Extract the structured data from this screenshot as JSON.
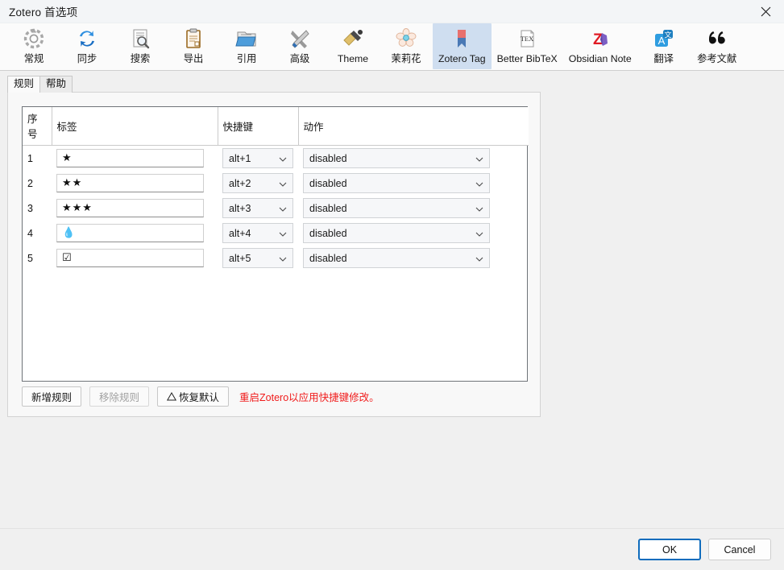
{
  "window": {
    "title": "Zotero 首选项",
    "close_label": "✕",
    "close_icon": "close-icon"
  },
  "toolbar": {
    "tabs": [
      {
        "label": "常规",
        "icon": "gear-icon",
        "selected": false
      },
      {
        "label": "同步",
        "icon": "sync-arrows-icon",
        "selected": false
      },
      {
        "label": "搜索",
        "icon": "document-search-icon",
        "selected": false
      },
      {
        "label": "导出",
        "icon": "clipboard-icon",
        "selected": false
      },
      {
        "label": "引用",
        "icon": "folder-icon",
        "selected": false
      },
      {
        "label": "高级",
        "icon": "tools-icon",
        "selected": false
      },
      {
        "label": "Theme",
        "icon": "paintbrush-icon",
        "selected": false
      },
      {
        "label": "茉莉花",
        "icon": "flower-icon",
        "selected": false
      },
      {
        "label": "Zotero Tag",
        "icon": "bookmark-icon",
        "selected": true
      },
      {
        "label": "Better BibTeX",
        "icon": "tex-document-icon",
        "selected": false
      },
      {
        "label": "Obsidian Note",
        "icon": "obsidian-icon",
        "selected": false
      },
      {
        "label": "翻译",
        "icon": "translate-icon",
        "selected": false
      },
      {
        "label": "参考文献",
        "icon": "quotation-marks-icon",
        "selected": false
      }
    ]
  },
  "subtabs": [
    {
      "label": "规则",
      "selected": true
    },
    {
      "label": "帮助",
      "selected": false
    }
  ],
  "rules_table": {
    "headers": [
      "序号",
      "标签",
      "快捷键",
      "动作"
    ],
    "rows": [
      {
        "index": "1",
        "tag": "★",
        "tag_icon": "star-1-icon",
        "shortcut": "alt+1",
        "action": "disabled"
      },
      {
        "index": "2",
        "tag": "★★",
        "tag_icon": "star-2-icon",
        "shortcut": "alt+2",
        "action": "disabled"
      },
      {
        "index": "3",
        "tag": "★★★",
        "tag_icon": "star-3-icon",
        "shortcut": "alt+3",
        "action": "disabled"
      },
      {
        "index": "4",
        "tag": "💧",
        "tag_icon": "droplet-icon",
        "shortcut": "alt+4",
        "action": "disabled"
      },
      {
        "index": "5",
        "tag": "☑",
        "tag_icon": "checkbox-icon",
        "shortcut": "alt+5",
        "action": "disabled"
      }
    ]
  },
  "panel_buttons": {
    "add_rule": "新增规则",
    "remove_rule": "移除规则",
    "restore_default": "恢复默认",
    "warning_icon": "warning-triangle-icon",
    "restart_notice": "重启Zotero以应用快捷键修改。"
  },
  "footer": {
    "ok": "OK",
    "cancel": "Cancel"
  },
  "colors": {
    "selected_tab_bg": "#cfdef2",
    "warning_red": "#f01c1c",
    "primary_border": "#0f6cbd"
  }
}
